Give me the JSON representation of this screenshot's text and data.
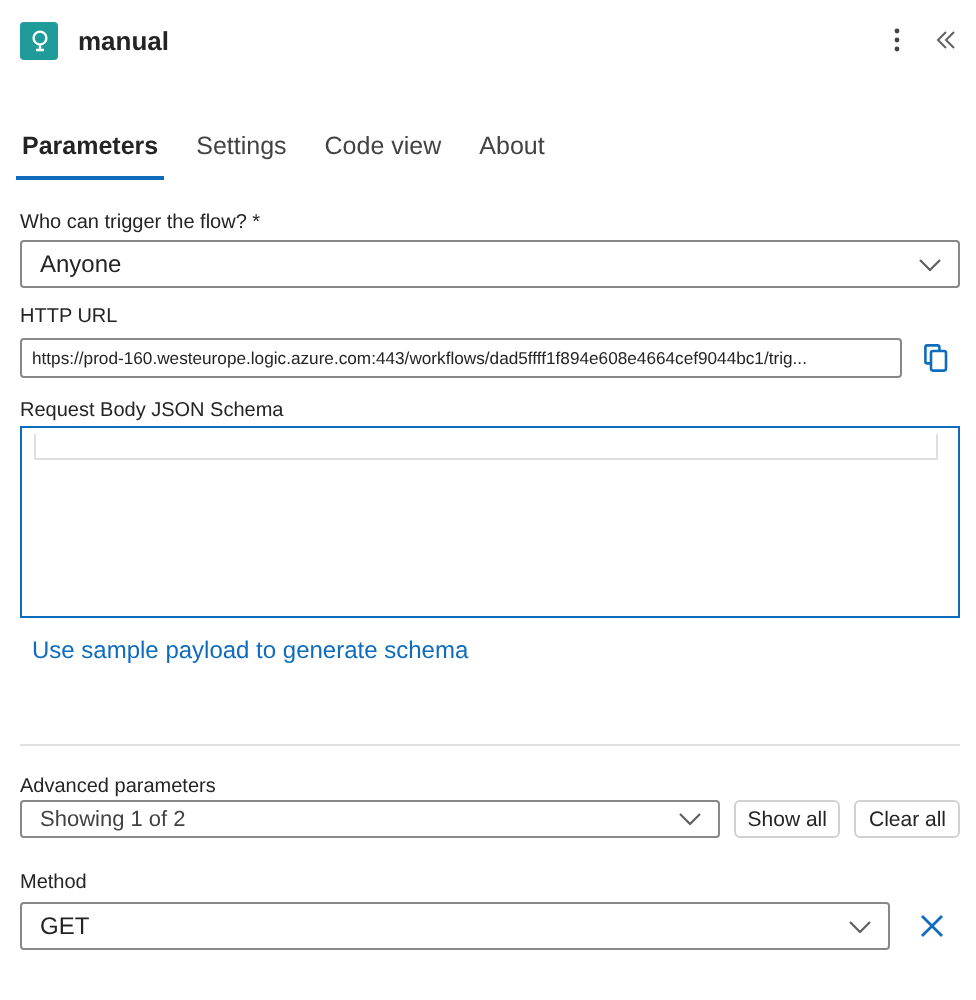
{
  "header": {
    "title": "manual"
  },
  "tabs": [
    {
      "label": "Parameters",
      "selected": true
    },
    {
      "label": "Settings",
      "selected": false
    },
    {
      "label": "Code view",
      "selected": false
    },
    {
      "label": "About",
      "selected": false
    }
  ],
  "who_can_trigger": {
    "label": "Who can trigger the flow?",
    "required_mark": "*",
    "value": "Anyone"
  },
  "http_url": {
    "label": "HTTP URL",
    "value": "https://prod-160.westeurope.logic.azure.com:443/workflows/dad5ffff1f894e608e4664cef9044bc1/trig..."
  },
  "request_body_schema": {
    "label": "Request Body JSON Schema"
  },
  "sample_payload_link": "Use sample payload to generate schema",
  "advanced_parameters": {
    "label": "Advanced parameters",
    "value": "Showing 1 of 2",
    "buttons": [
      "Show all",
      "Clear all"
    ]
  },
  "method": {
    "label": "Method",
    "value": "GET"
  }
}
